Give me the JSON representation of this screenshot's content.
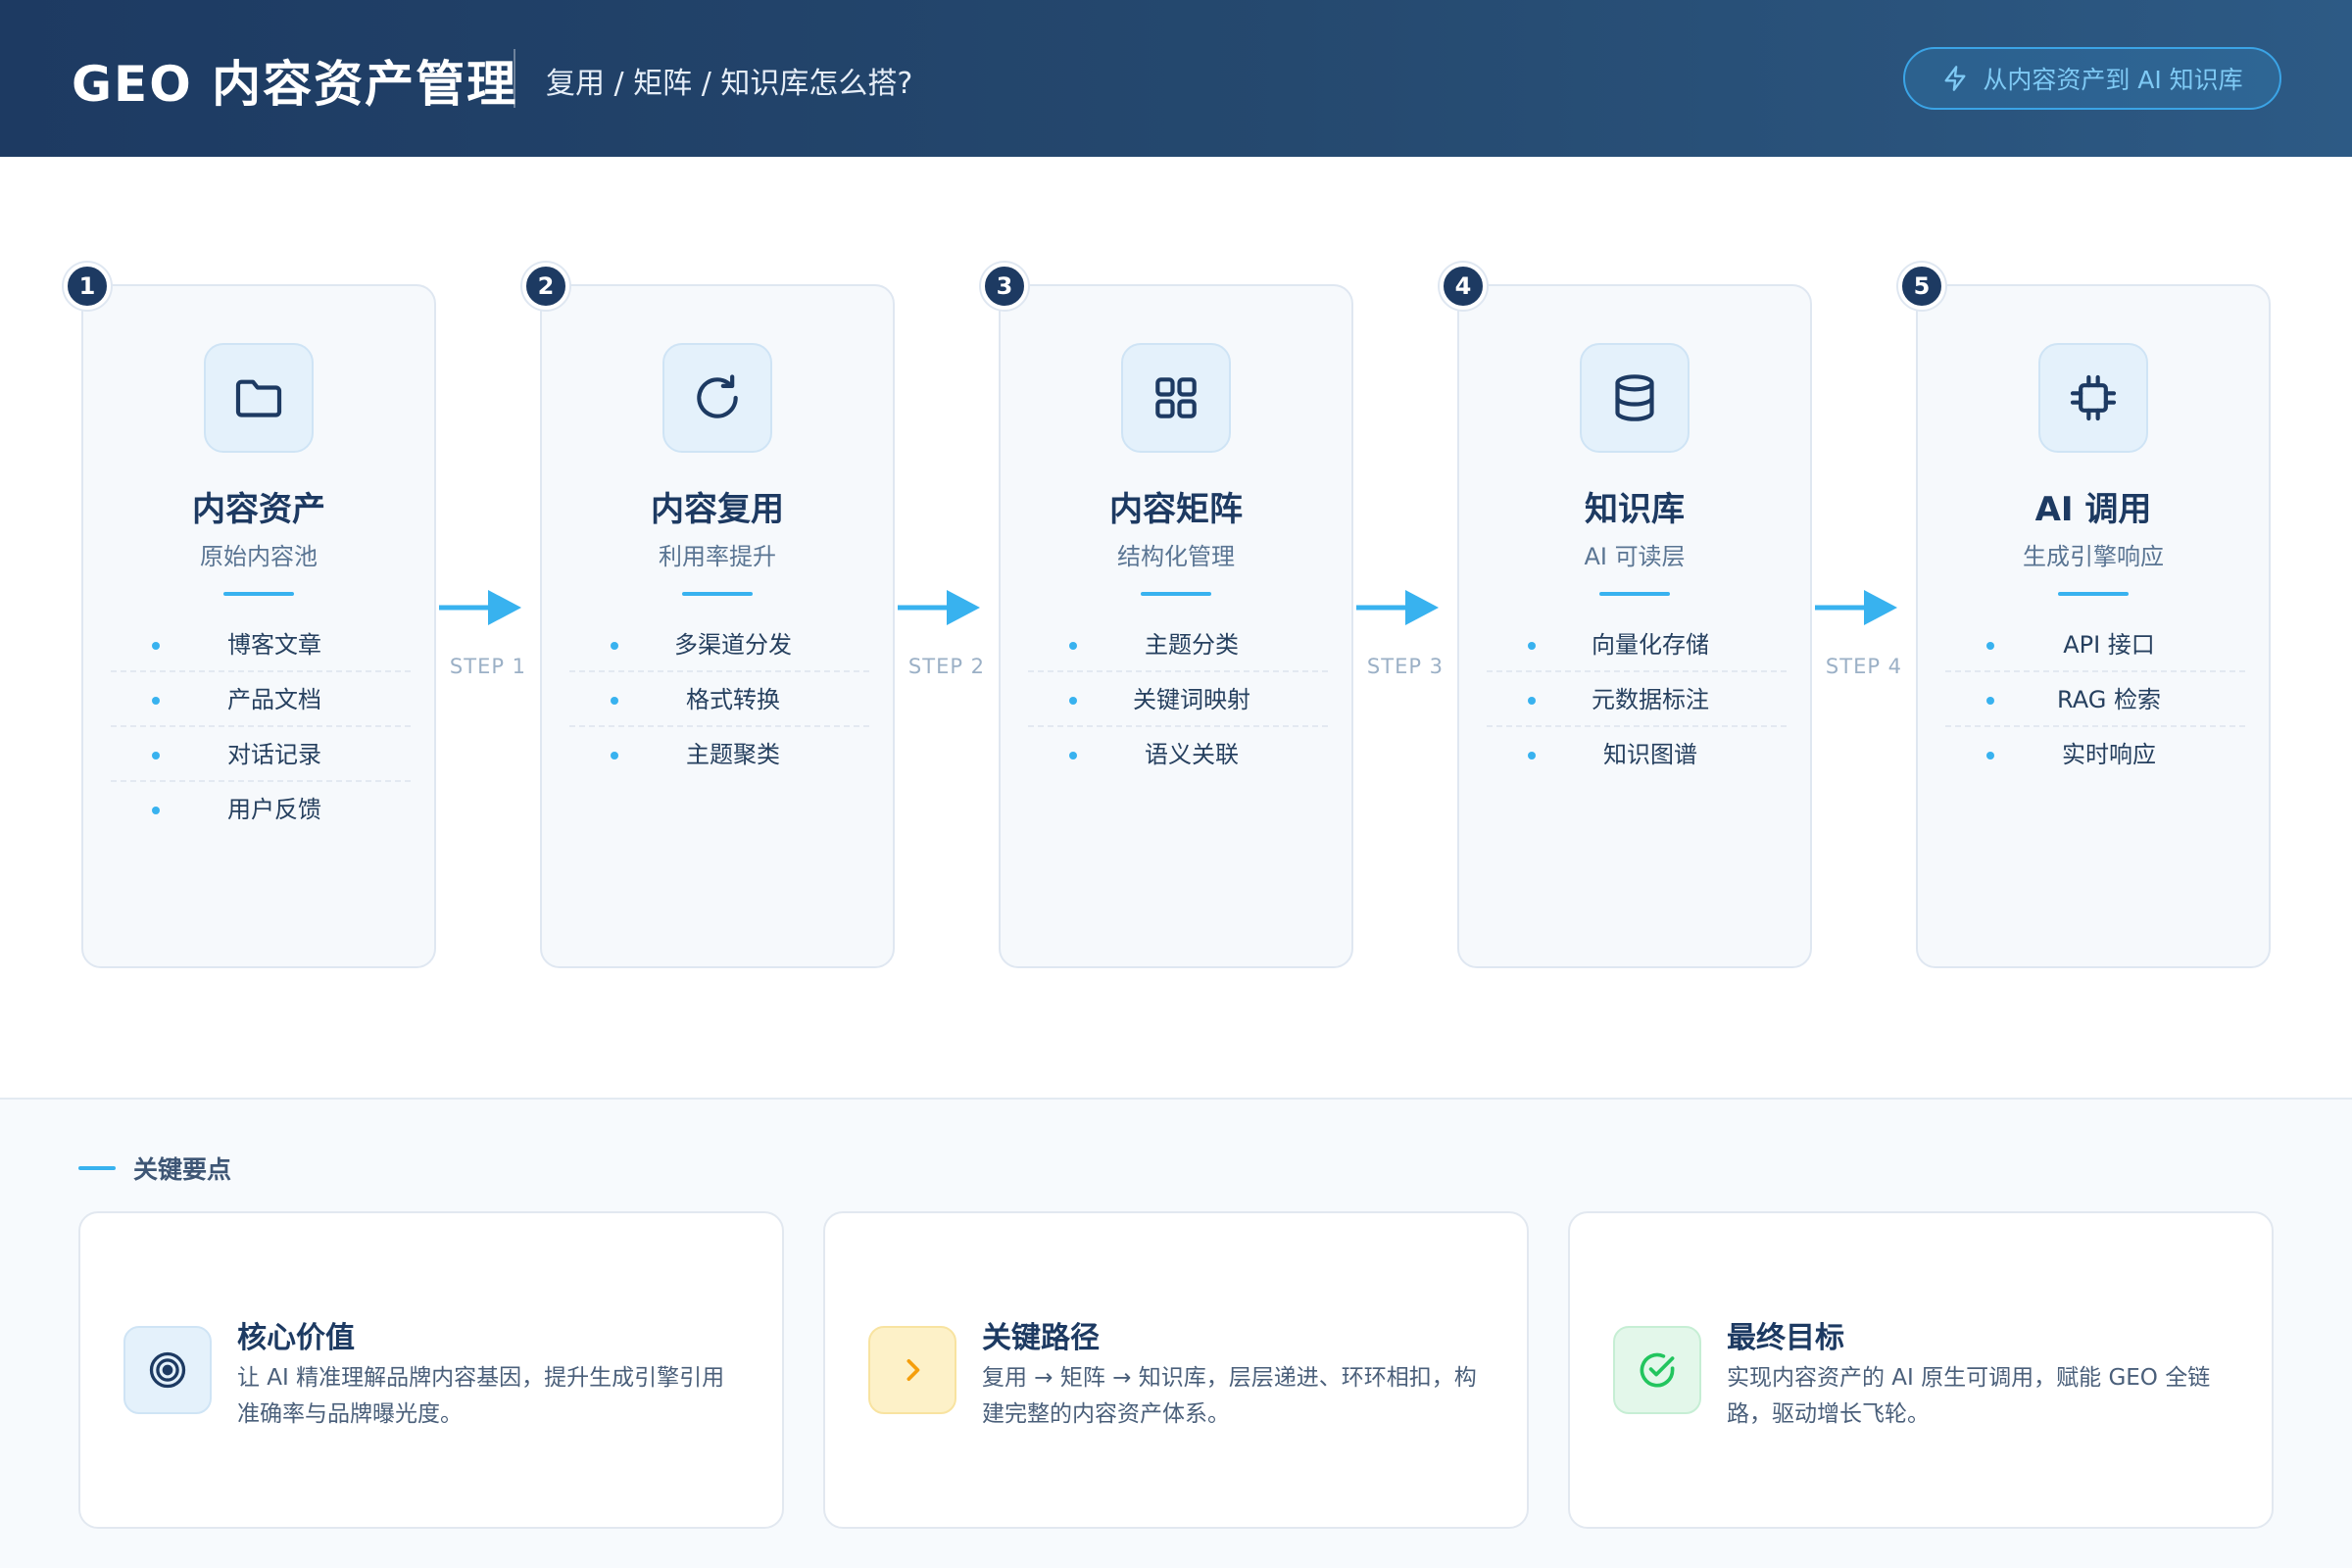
{
  "header": {
    "title": "GEO 内容资产管理",
    "subtitle": "复用 / 矩阵 / 知识库怎么搭?",
    "tag": "从内容资产到 AI 知识库",
    "tag_icon": "lightning-icon"
  },
  "steps": [
    {
      "number": "1",
      "icon": "folder-icon",
      "title": "内容资产",
      "subtitle": "原始内容池",
      "items": [
        "博客文章",
        "产品文档",
        "对话记录",
        "用户反馈"
      ]
    },
    {
      "number": "2",
      "icon": "refresh-icon",
      "title": "内容复用",
      "subtitle": "利用率提升",
      "items": [
        "多渠道分发",
        "格式转换",
        "主题聚类"
      ]
    },
    {
      "number": "3",
      "icon": "grid-icon",
      "title": "内容矩阵",
      "subtitle": "结构化管理",
      "items": [
        "主题分类",
        "关键词映射",
        "语义关联"
      ]
    },
    {
      "number": "4",
      "icon": "database-icon",
      "title": "知识库",
      "subtitle": "AI 可读层",
      "items": [
        "向量化存储",
        "元数据标注",
        "知识图谱"
      ]
    },
    {
      "number": "5",
      "icon": "chip-icon",
      "title": "AI 调用",
      "subtitle": "生成引擎响应",
      "items": [
        "API 接口",
        "RAG 检索",
        "实时响应"
      ]
    }
  ],
  "connectors": [
    "STEP 1",
    "STEP 2",
    "STEP 3",
    "STEP 4"
  ],
  "key_points": {
    "heading": "关键要点",
    "cards": [
      {
        "icon": "target-icon",
        "title": "核心价值",
        "desc": "让 AI 精准理解品牌内容基因，提升生成引擎引用准确率与品牌曝光度。"
      },
      {
        "icon": "chevron-right-icon",
        "title": "关键路径",
        "desc": "复用 → 矩阵 → 知识库，层层递进、环环相扣，构建完整的内容资产体系。"
      },
      {
        "icon": "check-circle-icon",
        "title": "最终目标",
        "desc": "实现内容资产的 AI 原生可调用，赋能 GEO 全链路，驱动增长飞轮。"
      }
    ]
  },
  "colors": {
    "header_dark": "#1d3a62",
    "accent_blue": "#38b2ef",
    "card_bg": "#f6f9fc",
    "amber": "#f59e0b",
    "green": "#22c55e"
  }
}
